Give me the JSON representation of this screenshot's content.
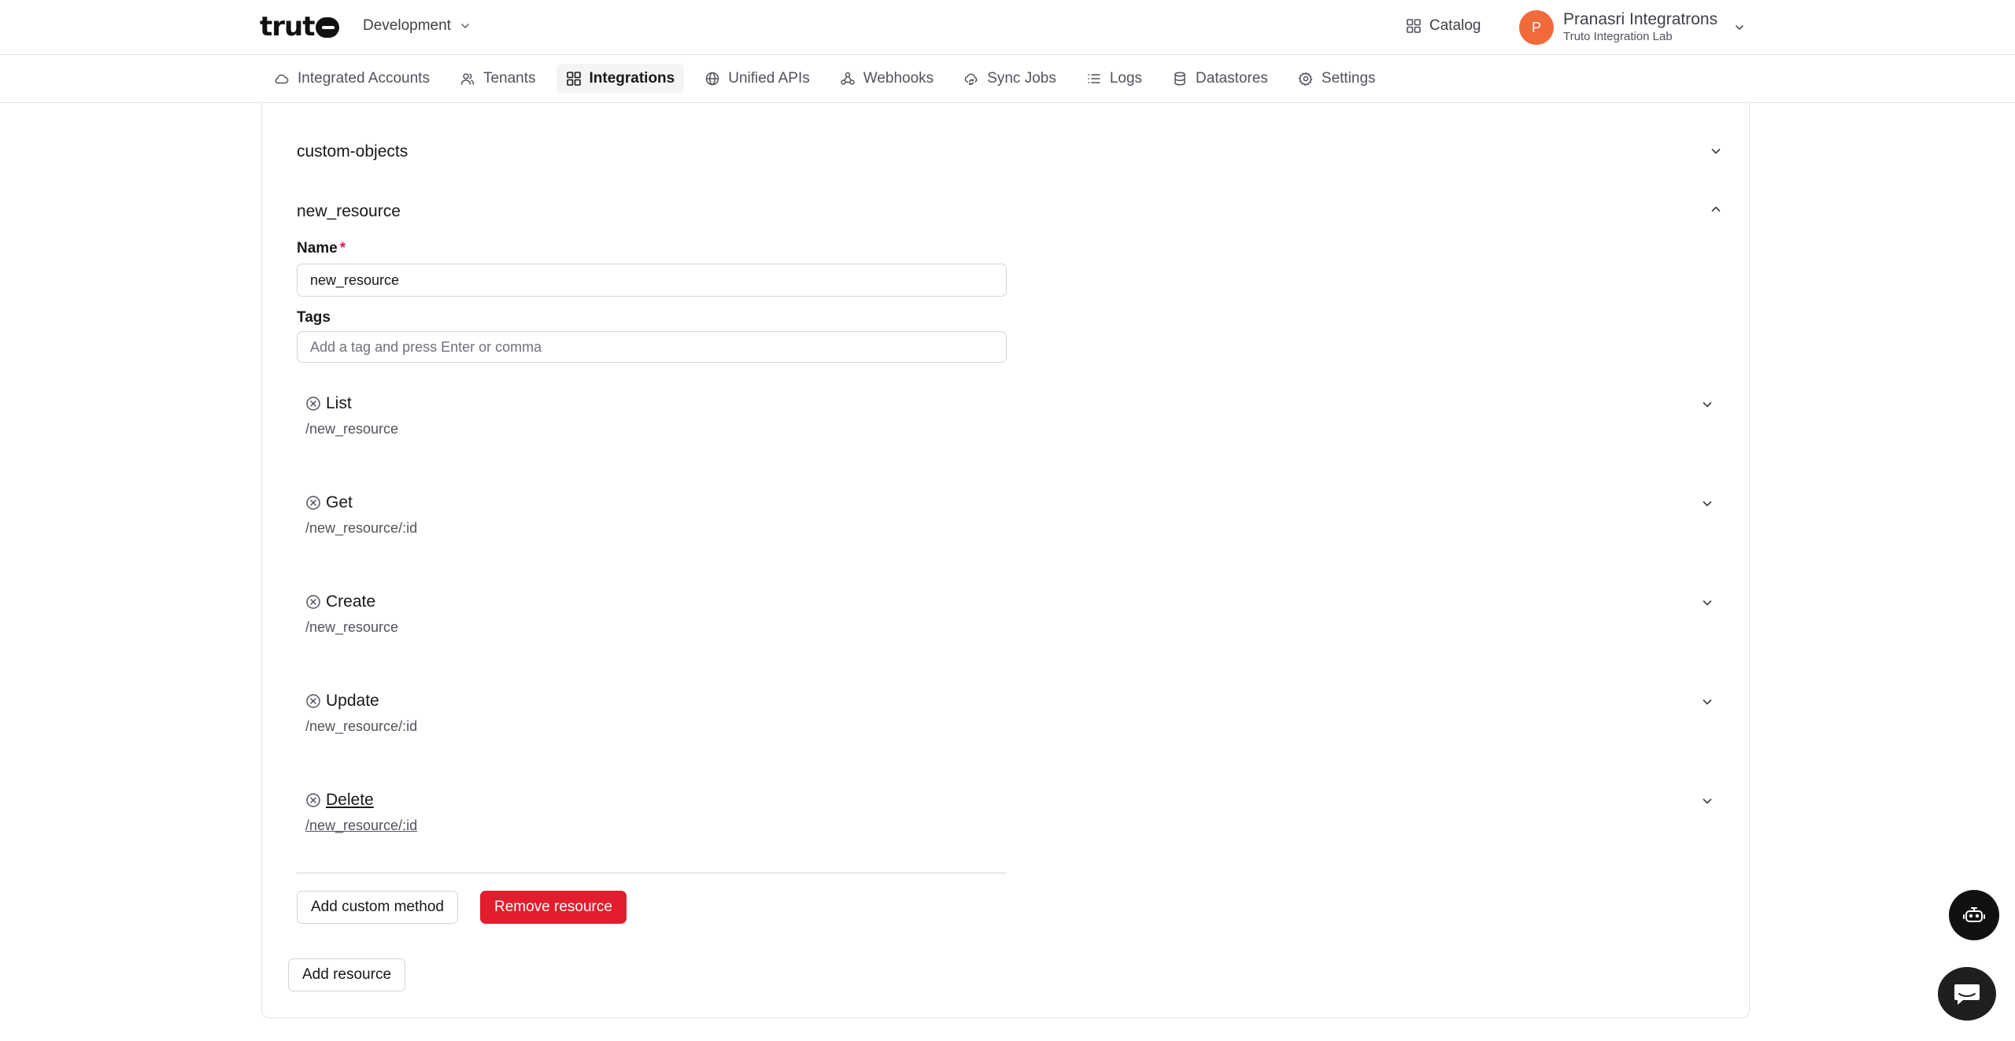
{
  "header": {
    "logo_text": "truto",
    "environment": "Development",
    "catalog_label": "Catalog",
    "user": {
      "initial": "P",
      "name": "Pranasri Integratrons",
      "org": "Truto Integration Lab"
    }
  },
  "nav": {
    "items": [
      {
        "label": "Integrated Accounts",
        "icon": "cloud-icon"
      },
      {
        "label": "Tenants",
        "icon": "users-icon"
      },
      {
        "label": "Integrations",
        "icon": "grid-icon",
        "active": true
      },
      {
        "label": "Unified APIs",
        "icon": "globe-icon"
      },
      {
        "label": "Webhooks",
        "icon": "webhook-icon"
      },
      {
        "label": "Sync Jobs",
        "icon": "cloud-sync-icon"
      },
      {
        "label": "Logs",
        "icon": "list-icon"
      },
      {
        "label": "Datastores",
        "icon": "database-icon"
      },
      {
        "label": "Settings",
        "icon": "gear-icon"
      }
    ]
  },
  "resources": {
    "collapsed_title": "custom-objects",
    "expanded_title": "new_resource",
    "form": {
      "name_label": "Name",
      "required_mark": "*",
      "name_value": "new_resource",
      "tags_label": "Tags",
      "tags_placeholder": "Add a tag and press Enter or comma"
    },
    "methods": [
      {
        "name": "List",
        "path": "/new_resource"
      },
      {
        "name": "Get",
        "path": "/new_resource/:id"
      },
      {
        "name": "Create",
        "path": "/new_resource"
      },
      {
        "name": "Update",
        "path": "/new_resource/:id"
      },
      {
        "name": "Delete",
        "path": "/new_resource/:id"
      }
    ],
    "add_custom_method_label": "Add custom method",
    "remove_resource_label": "Remove resource",
    "add_resource_label": "Add resource"
  }
}
